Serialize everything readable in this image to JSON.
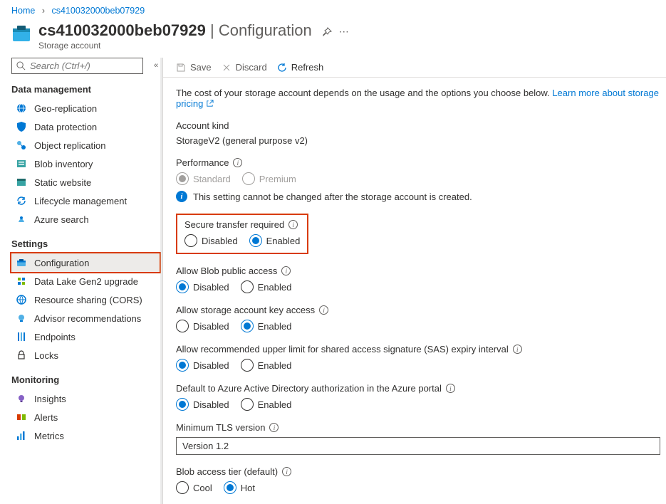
{
  "breadcrumb": {
    "home": "Home",
    "resource": "cs410032000beb07929"
  },
  "header": {
    "title_name": "cs410032000beb07929",
    "title_section": "Configuration",
    "subtitle": "Storage account"
  },
  "search": {
    "placeholder": "Search (Ctrl+/)"
  },
  "sidebar": {
    "sections": [
      {
        "title": "Data management",
        "items": [
          {
            "label": "Geo-replication",
            "key": "geo"
          },
          {
            "label": "Data protection",
            "key": "dataprot"
          },
          {
            "label": "Object replication",
            "key": "objrep"
          },
          {
            "label": "Blob inventory",
            "key": "blobinv"
          },
          {
            "label": "Static website",
            "key": "static"
          },
          {
            "label": "Lifecycle management",
            "key": "lifecycle"
          },
          {
            "label": "Azure search",
            "key": "search"
          }
        ]
      },
      {
        "title": "Settings",
        "items": [
          {
            "label": "Configuration",
            "key": "config",
            "active": true,
            "highlight": true
          },
          {
            "label": "Data Lake Gen2 upgrade",
            "key": "datalake"
          },
          {
            "label": "Resource sharing (CORS)",
            "key": "cors"
          },
          {
            "label": "Advisor recommendations",
            "key": "advisor"
          },
          {
            "label": "Endpoints",
            "key": "endpoints"
          },
          {
            "label": "Locks",
            "key": "locks"
          }
        ]
      },
      {
        "title": "Monitoring",
        "items": [
          {
            "label": "Insights",
            "key": "insights"
          },
          {
            "label": "Alerts",
            "key": "alerts"
          },
          {
            "label": "Metrics",
            "key": "metrics"
          }
        ]
      }
    ]
  },
  "toolbar": {
    "save": "Save",
    "discard": "Discard",
    "refresh": "Refresh"
  },
  "intro": {
    "text": "The cost of your storage account depends on the usage and the options you choose below.",
    "link": "Learn more about storage pricing"
  },
  "account_kind": {
    "label": "Account kind",
    "value": "StorageV2 (general purpose v2)"
  },
  "performance": {
    "label": "Performance",
    "options": [
      "Standard",
      "Premium"
    ],
    "selected": "Standard",
    "notice": "This setting cannot be changed after the storage account is created."
  },
  "secure_transfer": {
    "label": "Secure transfer required",
    "options": [
      "Disabled",
      "Enabled"
    ],
    "selected": "Enabled"
  },
  "blob_public": {
    "label": "Allow Blob public access",
    "options": [
      "Disabled",
      "Enabled"
    ],
    "selected": "Disabled"
  },
  "key_access": {
    "label": "Allow storage account key access",
    "options": [
      "Disabled",
      "Enabled"
    ],
    "selected": "Enabled"
  },
  "sas_expiry": {
    "label": "Allow recommended upper limit for shared access signature (SAS) expiry interval",
    "options": [
      "Disabled",
      "Enabled"
    ],
    "selected": "Disabled"
  },
  "aad_default": {
    "label": "Default to Azure Active Directory authorization in the Azure portal",
    "options": [
      "Disabled",
      "Enabled"
    ],
    "selected": "Disabled"
  },
  "tls": {
    "label": "Minimum TLS version",
    "value": "Version 1.2"
  },
  "access_tier": {
    "label": "Blob access tier (default)",
    "options": [
      "Cool",
      "Hot"
    ],
    "selected": "Hot"
  }
}
